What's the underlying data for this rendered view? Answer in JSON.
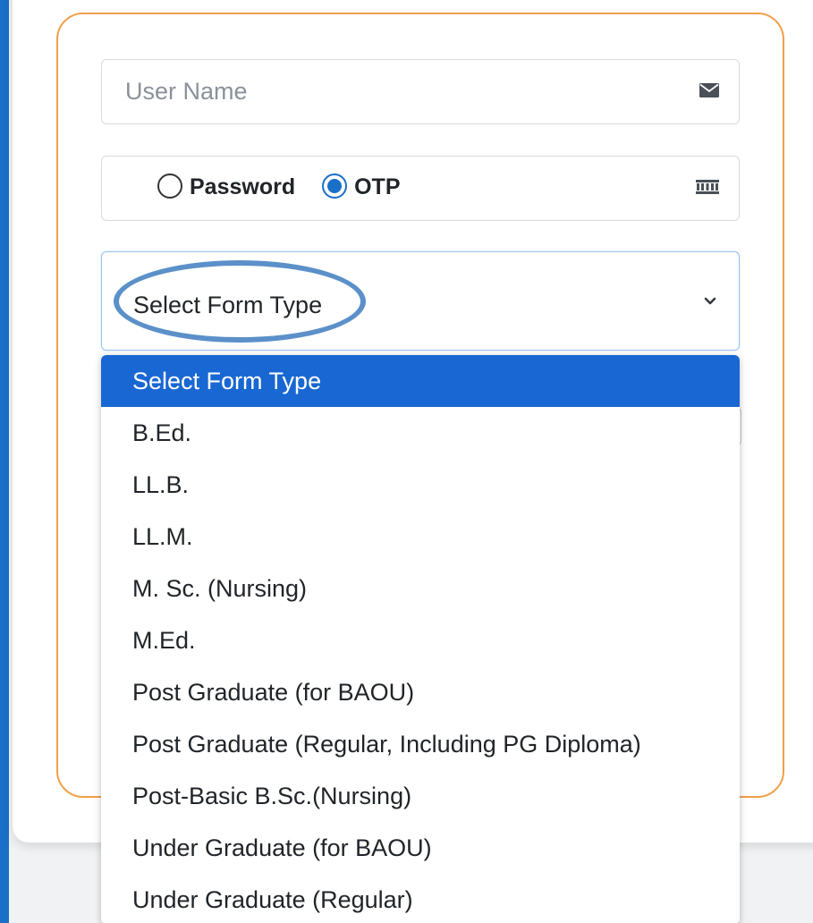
{
  "login_form": {
    "username": {
      "placeholder": "User Name",
      "value": "",
      "icon": "envelope-icon"
    },
    "auth_method": {
      "options": [
        {
          "label": "Password",
          "selected": false
        },
        {
          "label": "OTP",
          "selected": true
        }
      ],
      "icon": "keypad-icon"
    },
    "form_type": {
      "selected_value": "Select Form Type",
      "icon": "chevron-down-icon",
      "options": [
        "Select Form Type",
        "B.Ed.",
        "LL.B.",
        "LL.M.",
        "M. Sc. (Nursing)",
        "M.Ed.",
        "Post Graduate (for BAOU)",
        "Post Graduate (Regular, Including PG Diploma)",
        "Post-Basic B.Sc.(Nursing)",
        "Under Graduate (for BAOU)",
        "Under Graduate (Regular)"
      ],
      "highlighted_index": 0
    }
  },
  "colors": {
    "accent": "#1a6fc9",
    "card_border": "#f0a04b",
    "option_highlight": "#1967d2",
    "annotation_ellipse": "#5b90c9"
  }
}
